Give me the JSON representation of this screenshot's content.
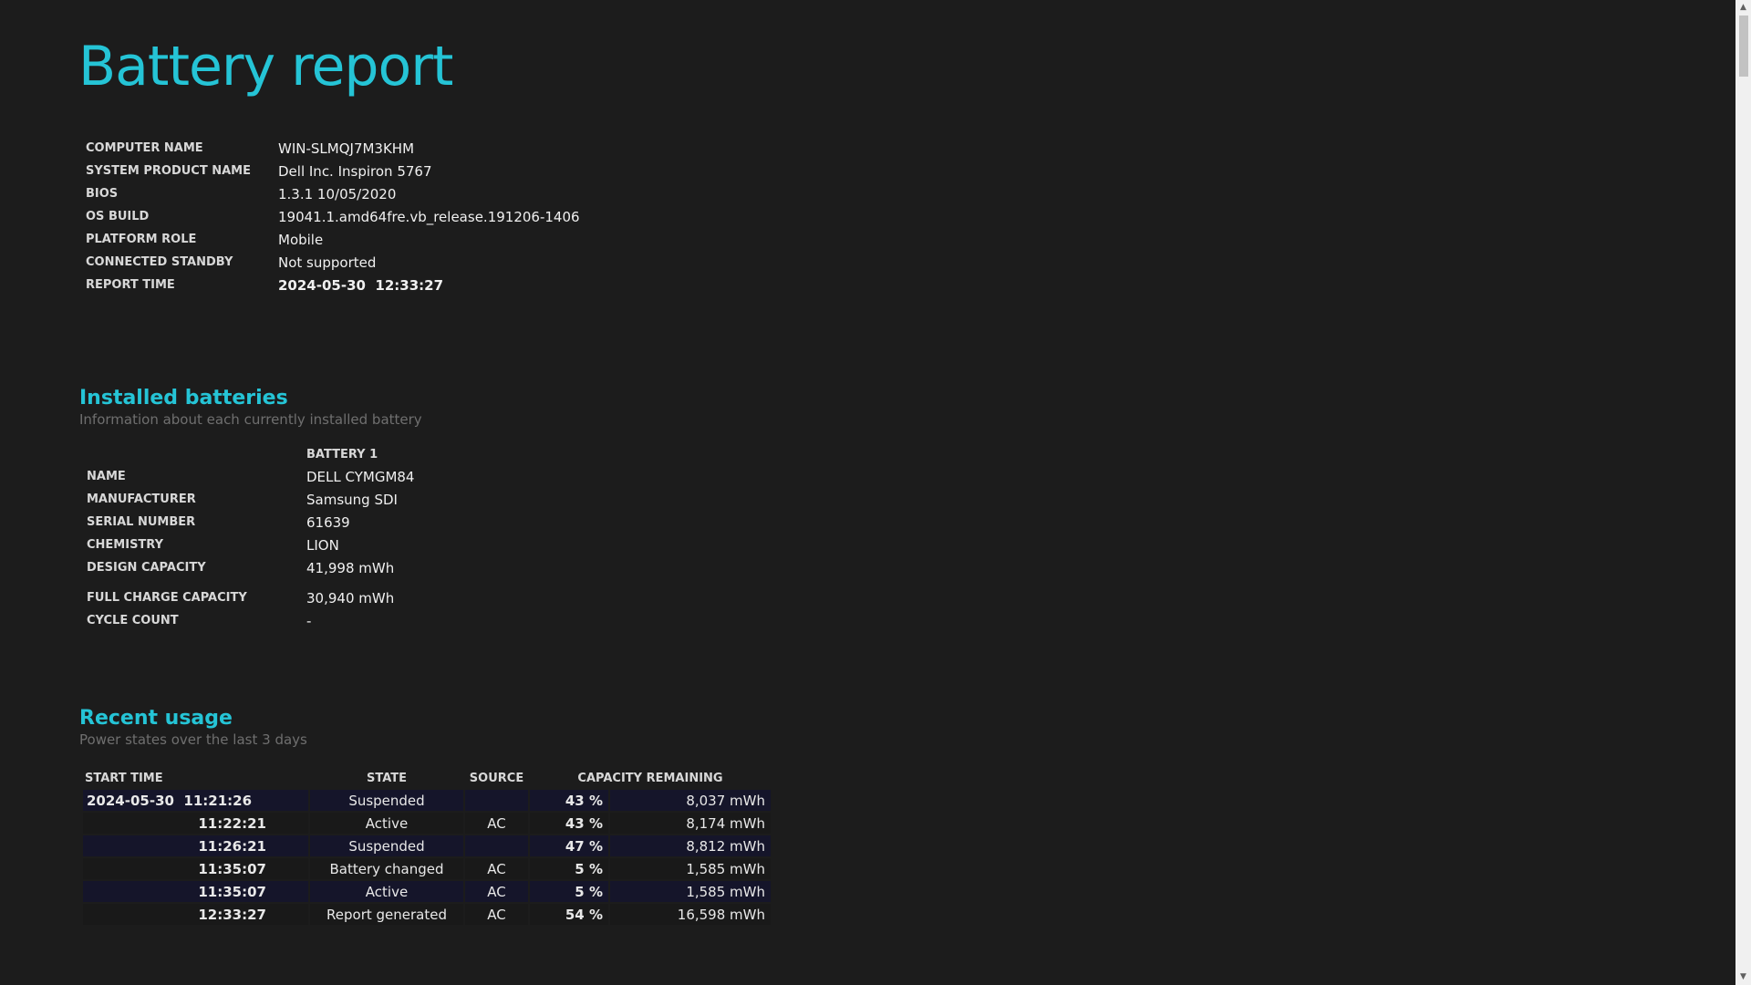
{
  "title": "Battery report",
  "system_info": [
    {
      "label": "COMPUTER NAME",
      "value": "WIN-SLMQJ7M3KHM"
    },
    {
      "label": "SYSTEM PRODUCT NAME",
      "value": "Dell Inc. Inspiron 5767"
    },
    {
      "label": "BIOS",
      "value": "1.3.1 10/05/2020"
    },
    {
      "label": "OS BUILD",
      "value": "19041.1.amd64fre.vb_release.191206-1406"
    },
    {
      "label": "PLATFORM ROLE",
      "value": "Mobile"
    },
    {
      "label": "CONNECTED STANDBY",
      "value": "Not supported"
    },
    {
      "label": "REPORT TIME",
      "value": "2024-05-30  12:33:27"
    }
  ],
  "installed_batteries": {
    "title": "Installed batteries",
    "subtitle": "Information about each currently installed battery",
    "column_header": "BATTERY 1",
    "rows": [
      {
        "label": "NAME",
        "value": "DELL CYMGM84"
      },
      {
        "label": "MANUFACTURER",
        "value": "Samsung SDI"
      },
      {
        "label": "SERIAL NUMBER",
        "value": "61639"
      },
      {
        "label": "CHEMISTRY",
        "value": "LION"
      },
      {
        "label": "DESIGN CAPACITY",
        "value": "41,998 mWh"
      },
      {
        "label": "FULL CHARGE CAPACITY",
        "value": "30,940 mWh"
      },
      {
        "label": "CYCLE COUNT",
        "value": "-"
      }
    ]
  },
  "recent_usage": {
    "title": "Recent usage",
    "subtitle": "Power states over the last 3 days",
    "headers": {
      "start_time": "START TIME",
      "state": "STATE",
      "source": "SOURCE",
      "capacity": "CAPACITY REMAINING"
    },
    "rows": [
      {
        "time": "2024-05-30  11:21:26",
        "state": "Suspended",
        "source": "",
        "pct": "43 %",
        "mwh": "8,037 mWh"
      },
      {
        "time": "11:22:21",
        "state": "Active",
        "source": "AC",
        "pct": "43 %",
        "mwh": "8,174 mWh"
      },
      {
        "time": "11:26:21",
        "state": "Suspended",
        "source": "",
        "pct": "47 %",
        "mwh": "8,812 mWh"
      },
      {
        "time": "11:35:07",
        "state": "Battery changed",
        "source": "AC",
        "pct": "5 %",
        "mwh": "1,585 mWh"
      },
      {
        "time": "11:35:07",
        "state": "Active",
        "source": "AC",
        "pct": "5 %",
        "mwh": "1,585 mWh"
      },
      {
        "time": "12:33:27",
        "state": "Report generated",
        "source": "AC",
        "pct": "54 %",
        "mwh": "16,598 mWh"
      }
    ]
  },
  "scrollbar": {
    "up_icon": "chevron-up-icon",
    "down_icon": "chevron-down-icon",
    "position_fraction": 0.0
  }
}
